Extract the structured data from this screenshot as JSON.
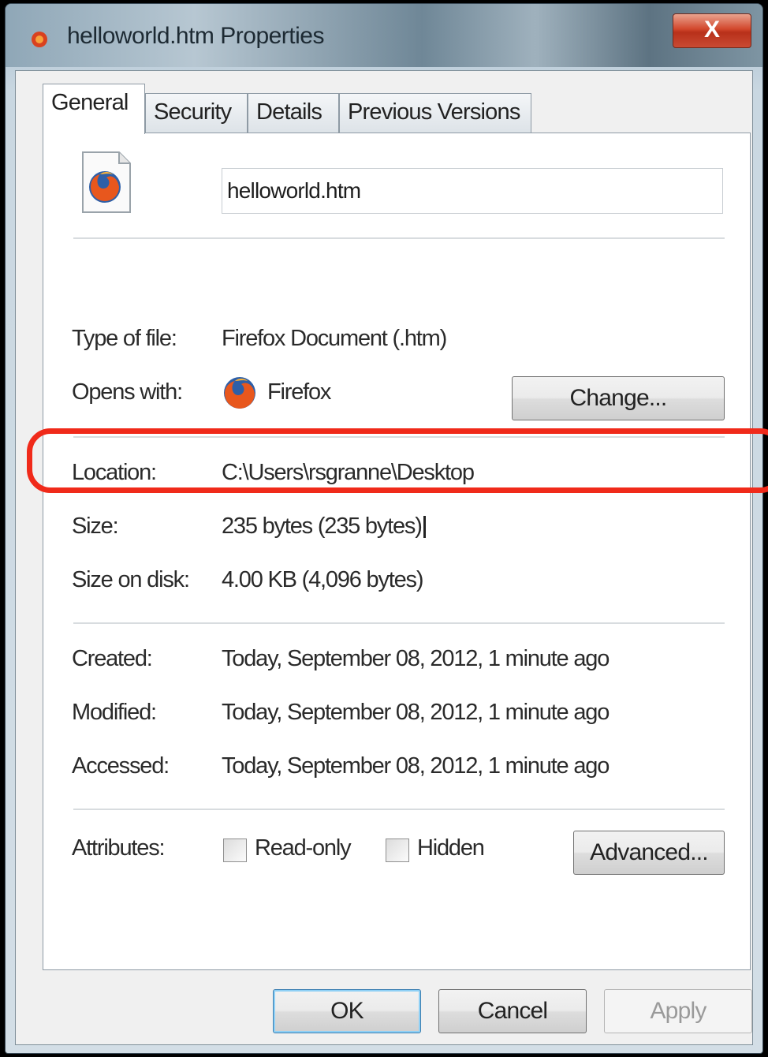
{
  "window": {
    "title": "helloworld.htm Properties",
    "close_label": "X"
  },
  "tabs": [
    {
      "label": "General",
      "active": true
    },
    {
      "label": "Security",
      "active": false
    },
    {
      "label": "Details",
      "active": false
    },
    {
      "label": "Previous Versions",
      "active": false
    }
  ],
  "general": {
    "filename": "helloworld.htm",
    "type_label": "Type of file:",
    "type_value": "Firefox Document (.htm)",
    "opens_label": "Opens with:",
    "opens_value": "Firefox",
    "change_button": "Change...",
    "location_label": "Location:",
    "location_value": "C:\\Users\\rsgranne\\Desktop",
    "size_label": "Size:",
    "size_value": "235 bytes (235 bytes)",
    "size_on_disk_label": "Size on disk:",
    "size_on_disk_value": "4.00 KB (4,096 bytes)",
    "created_label": "Created:",
    "created_value": "Today, September 08, 2012, 1 minute ago",
    "modified_label": "Modified:",
    "modified_value": "Today, September 08, 2012, 1 minute ago",
    "accessed_label": "Accessed:",
    "accessed_value": "Today, September 08, 2012, 1 minute ago",
    "attributes_label": "Attributes:",
    "readonly_label": "Read-only",
    "readonly_checked": false,
    "hidden_label": "Hidden",
    "hidden_checked": false,
    "advanced_button": "Advanced..."
  },
  "footer": {
    "ok": "OK",
    "cancel": "Cancel",
    "apply": "Apply"
  },
  "colors": {
    "highlight": "#f02a1a"
  },
  "icons": {
    "title": "firefox-document-icon",
    "file": "firefox-document-icon",
    "opens_with": "firefox-icon"
  }
}
